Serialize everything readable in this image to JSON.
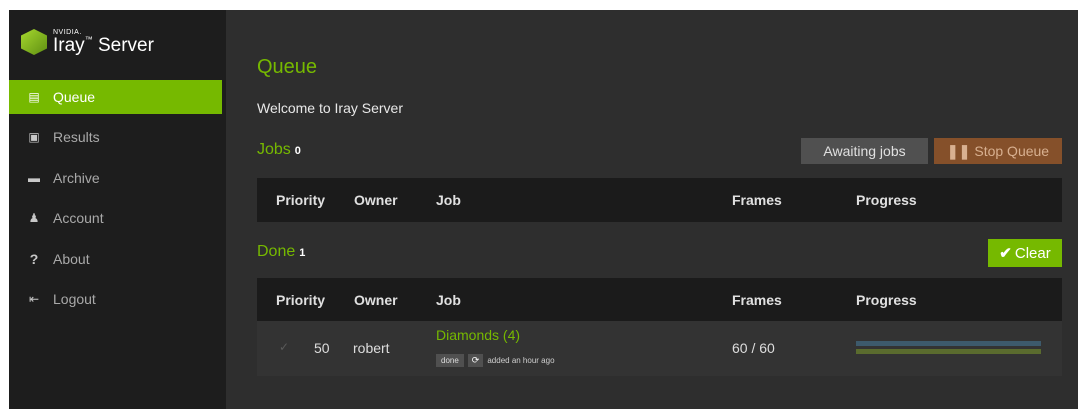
{
  "app": {
    "logo_brand": "NVIDIA.",
    "logo_product": "Iray",
    "logo_suffix": "Server"
  },
  "sidebar": {
    "items": [
      {
        "label": "Queue",
        "icon": "clipboard-icon",
        "active": true
      },
      {
        "label": "Results",
        "icon": "image-icon",
        "active": false
      },
      {
        "label": "Archive",
        "icon": "archive-icon",
        "active": false
      },
      {
        "label": "Account",
        "icon": "user-icon",
        "active": false
      },
      {
        "label": "About",
        "icon": "question-icon",
        "active": false
      },
      {
        "label": "Logout",
        "icon": "logout-icon",
        "active": false
      }
    ]
  },
  "main": {
    "title": "Queue",
    "welcome": "Welcome to Iray Server",
    "jobs": {
      "title": "Jobs",
      "count": "0",
      "awaiting_label": "Awaiting jobs",
      "stop_label": "Stop Queue",
      "stop_icon": "pause-icon"
    },
    "done": {
      "title": "Done",
      "count": "1",
      "clear_label": "Clear",
      "clear_icon": "check-icon"
    },
    "columns": [
      "Priority",
      "Owner",
      "Job",
      "Frames",
      "Progress"
    ],
    "done_rows": [
      {
        "status_icon": "check-icon",
        "priority": "50",
        "owner": "robert",
        "job": "Diamonds (4)",
        "status_badge": "done",
        "refresh_icon": "refresh-icon",
        "added": "added an hour ago",
        "frames": "60 / 60",
        "progress": [
          1.0,
          1.0
        ]
      }
    ]
  },
  "colors": {
    "accent": "#76b900",
    "stop": "#85502a",
    "progress_bar_1": "#3d5a6c",
    "progress_bar_2": "#5a6b2e"
  }
}
